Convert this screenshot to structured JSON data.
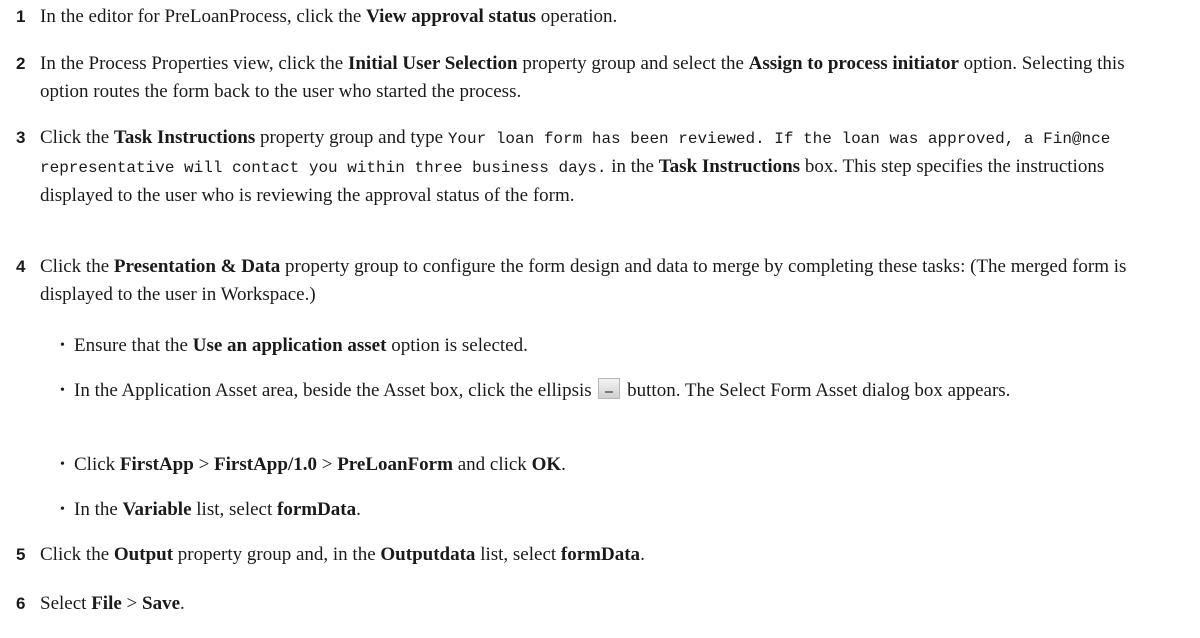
{
  "steps": [
    {
      "num": "1",
      "parts": [
        "In the editor for PreLoanProcess, click the ",
        "View approval status",
        " operation."
      ]
    },
    {
      "num": "2",
      "parts": [
        "In the Process Properties view, click the ",
        "Initial User Selection",
        " property group and select the ",
        "Assign to process initiator",
        " option. Selecting this option routes the form back to the user who started the process."
      ]
    },
    {
      "num": "3",
      "parts": [
        "Click the ",
        "Task Instructions",
        " property group and type ",
        "Your loan form has been reviewed. If the loan was approved, a Fin@nce representative will contact you within three business days.",
        " in the ",
        "Task Instructions",
        " box. This step specifies the instructions displayed to the user who is reviewing the approval status of the form."
      ]
    },
    {
      "num": "4",
      "parts": [
        "Click the ",
        "Presentation & Data",
        " property group to configure the form design and data to merge by completing these tasks: (The merged form is displayed to the user in Workspace.)"
      ]
    },
    {
      "num": "5",
      "parts": [
        "Click the ",
        "Output",
        " property group and, in the ",
        "Outputdata",
        " list, select ",
        "formData",
        "."
      ]
    },
    {
      "num": "6",
      "parts": [
        "Select ",
        "File",
        " > ",
        "Save",
        "."
      ]
    }
  ],
  "bullets": [
    [
      "Ensure that the ",
      "Use an application asset",
      " option is selected."
    ],
    [
      "In the Application Asset area, beside the Asset box, click the ellipsis ",
      " button. The Select Form Asset dialog box appears."
    ],
    [
      "Click ",
      "FirstApp",
      " > ",
      "FirstApp/1.0",
      " > ",
      "PreLoanForm",
      " and click ",
      "OK",
      "."
    ],
    [
      "In the ",
      "Variable",
      " list, select ",
      "formData",
      "."
    ]
  ],
  "icons": {
    "ellipsis_button": "ellipsis-button-icon"
  }
}
